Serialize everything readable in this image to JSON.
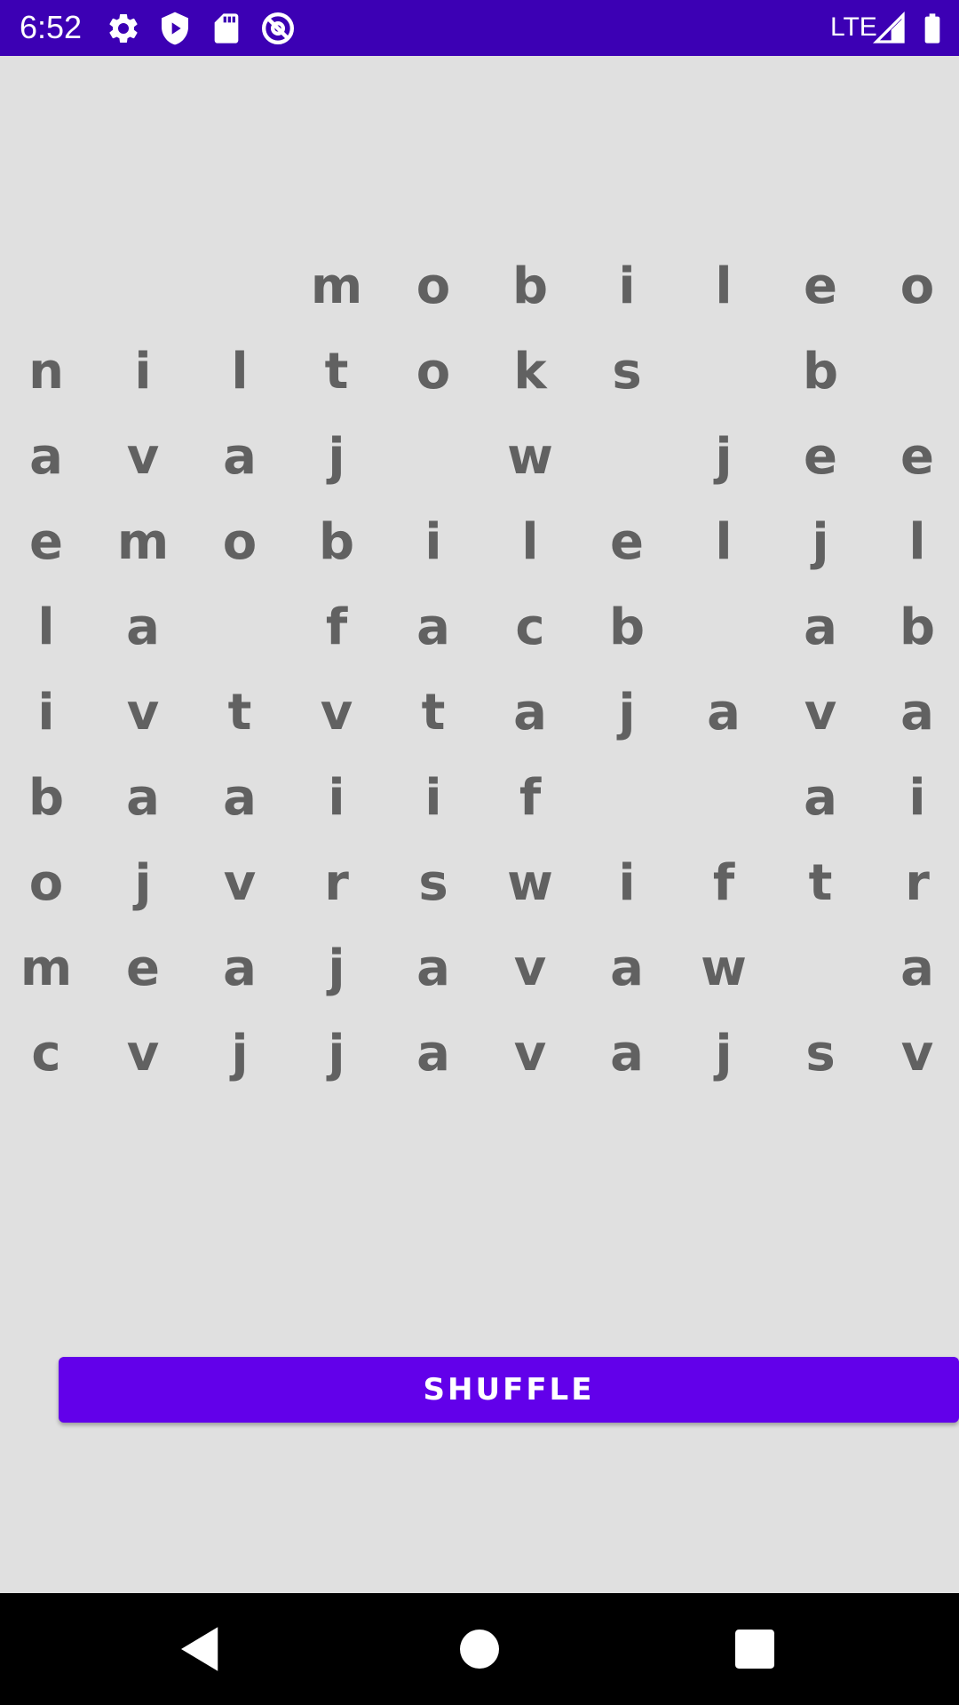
{
  "status_bar": {
    "time": "6:52",
    "network": "LTE",
    "icons": [
      "gear-icon",
      "shield-play-icon",
      "sd-card-icon",
      "at-sign-icon",
      "signal-icon",
      "battery-icon"
    ],
    "background": "#3c00b4"
  },
  "grid": {
    "text_color": "#616161",
    "rows": [
      [
        "",
        "",
        "",
        "m",
        "o",
        "b",
        "i",
        "l",
        "e",
        "o"
      ],
      [
        "n",
        "i",
        "l",
        "t",
        "o",
        "k",
        "s",
        "",
        "b",
        ""
      ],
      [
        "a",
        "v",
        "a",
        "j",
        "",
        "w",
        "",
        "j",
        "e",
        "e"
      ],
      [
        "e",
        "m",
        "o",
        "b",
        "i",
        "l",
        "e",
        "l",
        "j",
        "l"
      ],
      [
        "l",
        "a",
        "",
        "f",
        "a",
        "c",
        "b",
        "",
        "a",
        "b"
      ],
      [
        "i",
        "v",
        "t",
        "v",
        "t",
        "a",
        "j",
        "a",
        "v",
        "a"
      ],
      [
        "b",
        "a",
        "a",
        "i",
        "i",
        "f",
        "",
        "",
        "a",
        "i"
      ],
      [
        "o",
        "j",
        "v",
        "r",
        "s",
        "w",
        "i",
        "f",
        "t",
        "r"
      ],
      [
        "m",
        "e",
        "a",
        "j",
        "a",
        "v",
        "a",
        "w",
        "",
        "a"
      ],
      [
        "c",
        "v",
        "j",
        "j",
        "a",
        "v",
        "a",
        "j",
        "s",
        "v"
      ]
    ]
  },
  "shuffle": {
    "label": "SHUFFLE",
    "color": "#6200ea"
  },
  "nav_bar": {
    "buttons": [
      "back-icon",
      "home-icon",
      "recents-icon"
    ]
  },
  "background": "#e0e0e0"
}
